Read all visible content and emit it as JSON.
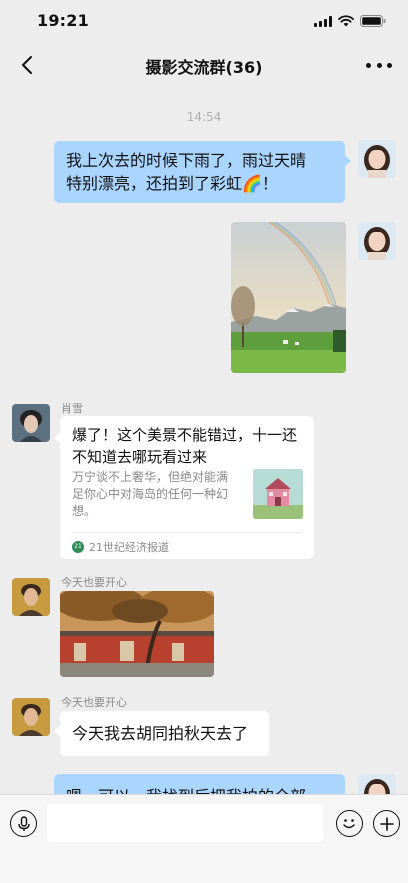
{
  "status_bar": {
    "time": "19:21"
  },
  "header": {
    "title": "摄影交流群(36)"
  },
  "chat": {
    "timestamp": "14:54",
    "messages": [
      {
        "type": "text",
        "side": "right",
        "text_line1": "我上次去的时候下雨了，雨过天晴",
        "text_line2": "特别漂亮，还拍到了彩虹🌈！"
      },
      {
        "type": "image",
        "side": "right",
        "subject": "rainbow-mountain-photo"
      },
      {
        "type": "link_card",
        "side": "left",
        "sender": "肖雪",
        "title": "爆了！这个美景不能错过，十一还不知道去哪玩看过来",
        "description": "万宁谈不上奢华，但绝对能满足你心中对海岛的任何一种幻想。",
        "source": "21世纪经济报道",
        "source_logo_text": "21"
      },
      {
        "type": "image",
        "side": "left",
        "sender": "今天也要开心",
        "subject": "hutong-autumn-photo"
      },
      {
        "type": "text",
        "side": "left",
        "sender": "今天也要开心",
        "text": "今天我去胡同拍秋天去了"
      },
      {
        "type": "text",
        "side": "right",
        "partial_text": "嗯，可以，我找到后把我拍的全部"
      }
    ]
  },
  "input_bar": {
    "placeholder": ""
  },
  "colors": {
    "background": "#ededed",
    "bubble_self": "#a9d5ff",
    "bubble_other": "#ffffff",
    "source_logo": "#2e8b57"
  }
}
